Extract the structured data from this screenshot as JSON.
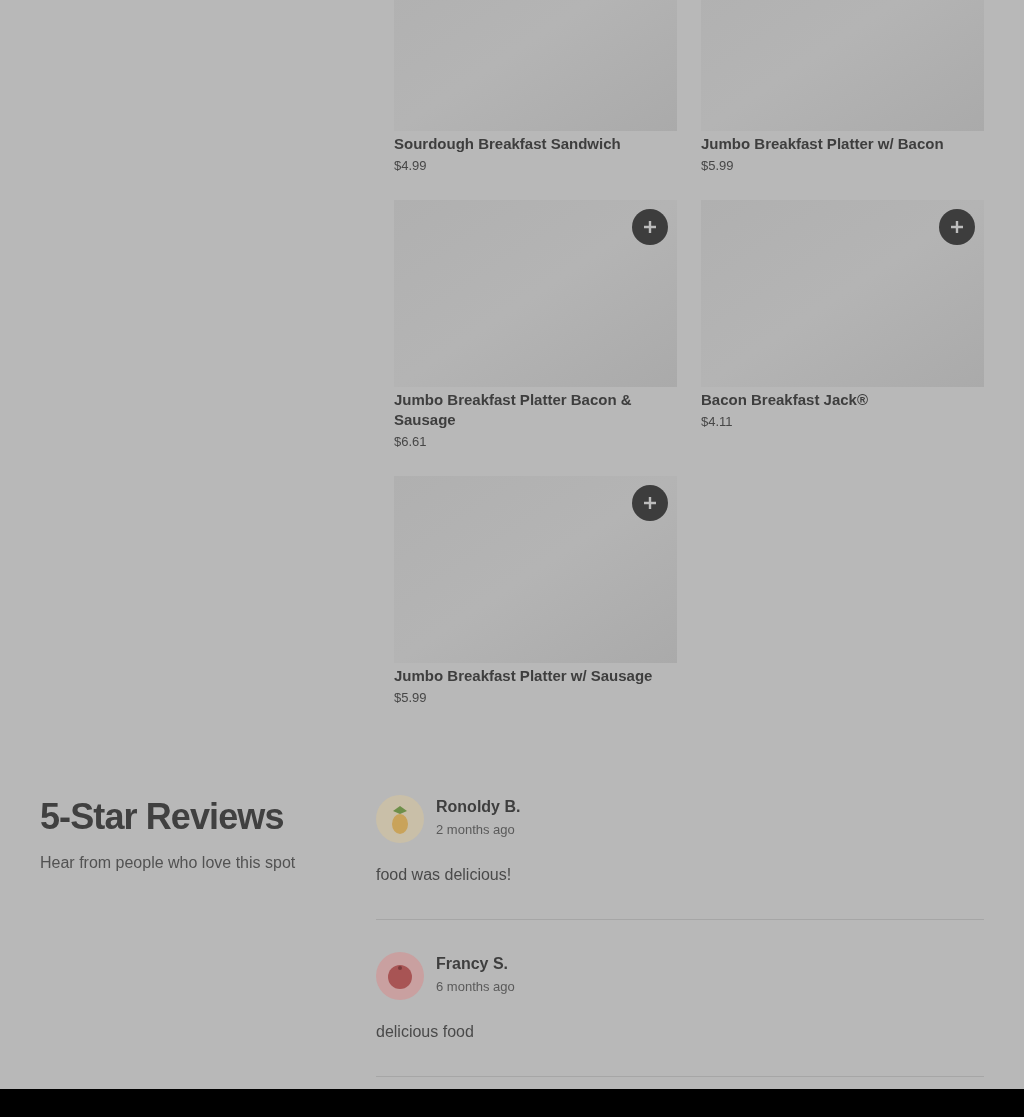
{
  "menu_items": [
    {
      "name": "Sourdough Breakfast Sandwich",
      "price": "$4.99",
      "add_button": false
    },
    {
      "name": "Jumbo Breakfast Platter w/ Bacon",
      "price": "$5.99",
      "add_button": false
    },
    {
      "name": "Jumbo Breakfast Platter Bacon & Sausage",
      "price": "$6.61",
      "add_button": true
    },
    {
      "name": "Bacon Breakfast Jack®",
      "price": "$4.11",
      "add_button": true
    },
    {
      "name": "Jumbo Breakfast Platter w/ Sausage",
      "price": "$5.99",
      "add_button": true
    }
  ],
  "reviews_section": {
    "title": "5-Star Reviews",
    "subtitle": "Hear from people who love this spot",
    "reviews": [
      {
        "author": "Ronoldy B.",
        "time": "2 months ago",
        "text": "food was delicious!",
        "kind": "pineapple"
      },
      {
        "author": "Francy S.",
        "time": "6 months ago",
        "text": "delicious food",
        "kind": "tomato"
      }
    ]
  }
}
